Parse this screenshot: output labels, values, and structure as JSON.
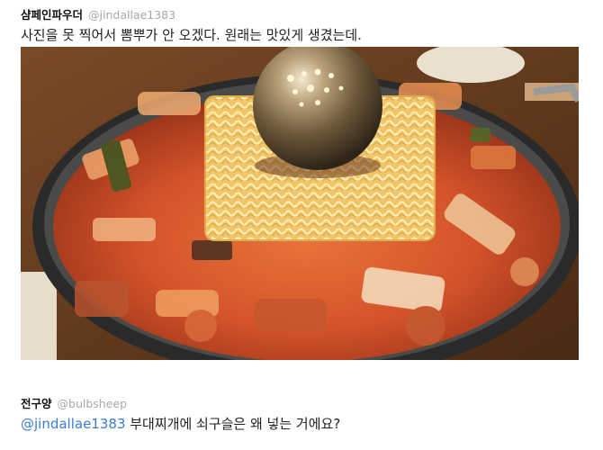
{
  "post1": {
    "name": "샴페인파우더",
    "handle": "@jindallae1383",
    "text": "사진을 못 찍어서 뽐뿌가 안 오겠다. 원래는 맛있게 생겼는데."
  },
  "photo": {
    "icon": "food-photo"
  },
  "post2": {
    "name": "전구양",
    "handle": "@bulbsheep",
    "mention": "@jindallae1383",
    "text": " 부대찌개에 쇠구슬은 왜 넣는 거에요?"
  }
}
